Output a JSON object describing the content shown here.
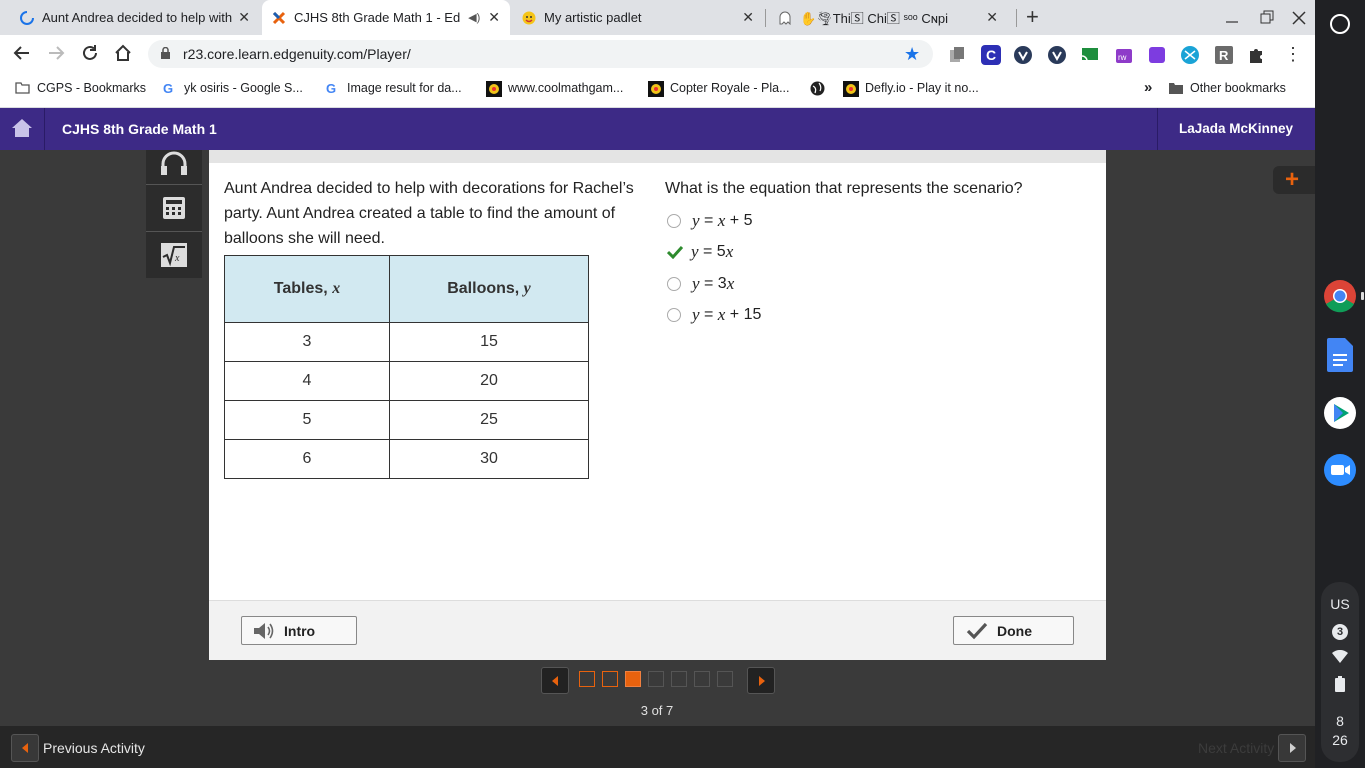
{
  "browser": {
    "tabs": [
      {
        "title": "Aunt Andrea decided to help with"
      },
      {
        "title": "CJHS 8th Grade Math 1 - Edg"
      },
      {
        "title": "My artistic padlet"
      },
      {
        "title": "✋🌪Thi🅂 Chi🅂 ˢᵒᵒ Cɴpi"
      }
    ],
    "new_tab": "+",
    "url": "r23.core.learn.edgenuity.com/Player/",
    "bookmarks": [
      {
        "label": "CGPS - Bookmarks"
      },
      {
        "label": "yk osiris - Google S..."
      },
      {
        "label": "Image result for da..."
      },
      {
        "label": "www.coolmathgam..."
      },
      {
        "label": "Copter Royale - Pla..."
      },
      {
        "label": ""
      },
      {
        "label": "Defly.io - Play it no..."
      }
    ],
    "overflow": "»",
    "other_bookmarks": "Other bookmarks",
    "ext_r": "R"
  },
  "app": {
    "course_title": "CJHS 8th Grade Math 1",
    "user_name": "LaJada McKinney",
    "problem": "Aunt Andrea decided to help with decorations for Rachel’s party. Aunt Andrea created a table to find the amount of balloons she will need.",
    "table": {
      "headers": [
        {
          "text": "Tables, ",
          "var": "x"
        },
        {
          "text": "Balloons, ",
          "var": "y"
        }
      ],
      "rows": [
        [
          "3",
          "15"
        ],
        [
          "4",
          "20"
        ],
        [
          "5",
          "25"
        ],
        [
          "6",
          "30"
        ]
      ]
    },
    "question": "What is the equation that represents the scenario?",
    "options": [
      {
        "y": "y",
        "eq": " = ",
        "rhs_var": "x",
        "rhs": " + 5",
        "selected": false
      },
      {
        "y": "y",
        "eq": " = ",
        "rhs_pre": "5",
        "rhs_var": "x",
        "rhs": "",
        "selected": true
      },
      {
        "y": "y",
        "eq": " = ",
        "rhs_pre": "3",
        "rhs_var": "x",
        "rhs": "",
        "selected": false
      },
      {
        "y": "y",
        "eq": " = ",
        "rhs_var": "x",
        "rhs": " + 15",
        "selected": false
      }
    ],
    "intro_label": "Intro",
    "done_label": "Done",
    "page_indicator": "3 of 7",
    "pages": [
      {
        "state": "visited"
      },
      {
        "state": "visited"
      },
      {
        "state": "current"
      },
      {
        "state": "unvisited"
      },
      {
        "state": "unvisited"
      },
      {
        "state": "unvisited"
      },
      {
        "state": "unvisited"
      }
    ],
    "previous_activity": "Previous Activity",
    "next_activity": "Next Activity",
    "plus": "+"
  },
  "system": {
    "lang": "US",
    "notif_count": "3",
    "time_h": "8",
    "time_m": "26"
  },
  "colors": {
    "header": "#3d2a86",
    "accent_orange": "#e8620e",
    "table_header": "#d2e9f1",
    "check_green": "#2e8b2e"
  }
}
